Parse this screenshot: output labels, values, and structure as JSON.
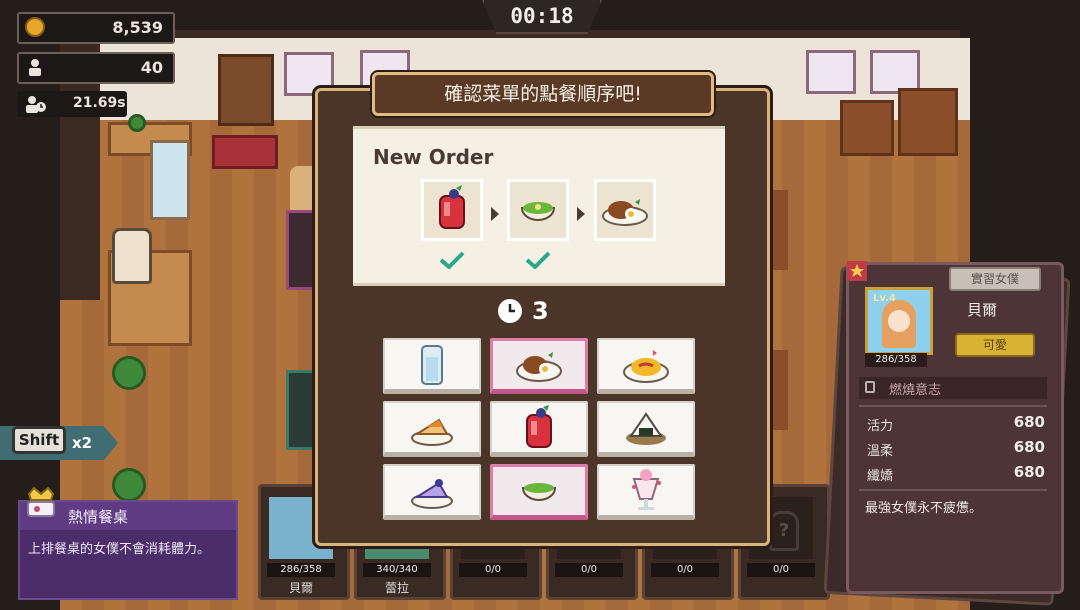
{
  "hud": {
    "timer": "00:18",
    "coins": "8,539",
    "customers": "40",
    "avg_time": "21.69s"
  },
  "shift": {
    "key_label": "Shift",
    "multiplier": "x2"
  },
  "table_info": {
    "title": "熱情餐桌",
    "description": "上排餐桌的女僕不會消耗體力。"
  },
  "dialog": {
    "title": "確認菜單的點餐順序吧!",
    "order_title": "New Order",
    "order_items": [
      "berry-drink-icon",
      "green-soup-icon",
      "hamburg-steak-icon"
    ],
    "order_completed": [
      true,
      true,
      false
    ],
    "time_left": "3",
    "menu": [
      {
        "icon": "water-glass-icon",
        "selected": false
      },
      {
        "icon": "hamburg-steak-icon",
        "selected": true
      },
      {
        "icon": "omelette-rice-icon",
        "selected": false
      },
      {
        "icon": "cake-slice-icon",
        "selected": false
      },
      {
        "icon": "berry-drink-icon",
        "selected": false
      },
      {
        "icon": "onigiri-icon",
        "selected": false
      },
      {
        "icon": "blueberry-cake-icon",
        "selected": false
      },
      {
        "icon": "green-soup-icon",
        "selected": true
      },
      {
        "icon": "parfait-icon",
        "selected": false
      }
    ]
  },
  "staff_slots": [
    {
      "hp": "286/358",
      "name": "貝爾",
      "has_character": true
    },
    {
      "hp": "340/340",
      "name": "蕾拉",
      "has_character": true
    },
    {
      "hp": "0/0",
      "name": "",
      "has_character": false
    },
    {
      "hp": "0/0",
      "name": "",
      "has_character": false
    },
    {
      "hp": "0/0",
      "name": "",
      "has_character": false
    },
    {
      "hp": "0/0",
      "name": "",
      "has_character": false
    }
  ],
  "maid_card": {
    "tag": "實習女僕",
    "level": "Lv.4",
    "hp": "286/358",
    "name": "貝爾",
    "button": "可愛",
    "locked_skill": "燃燒意志",
    "stats": [
      {
        "label": "活力",
        "value": "680"
      },
      {
        "label": "溫柔",
        "value": "680"
      },
      {
        "label": "纖嬌",
        "value": "680"
      }
    ],
    "description": "最強女僕永不疲憊。"
  },
  "colors": {
    "dialog_border": "#d9b47a",
    "selected_cell": "#e07aa8",
    "check_green": "#2aa88a",
    "info_panel": "#4b2d6a"
  }
}
